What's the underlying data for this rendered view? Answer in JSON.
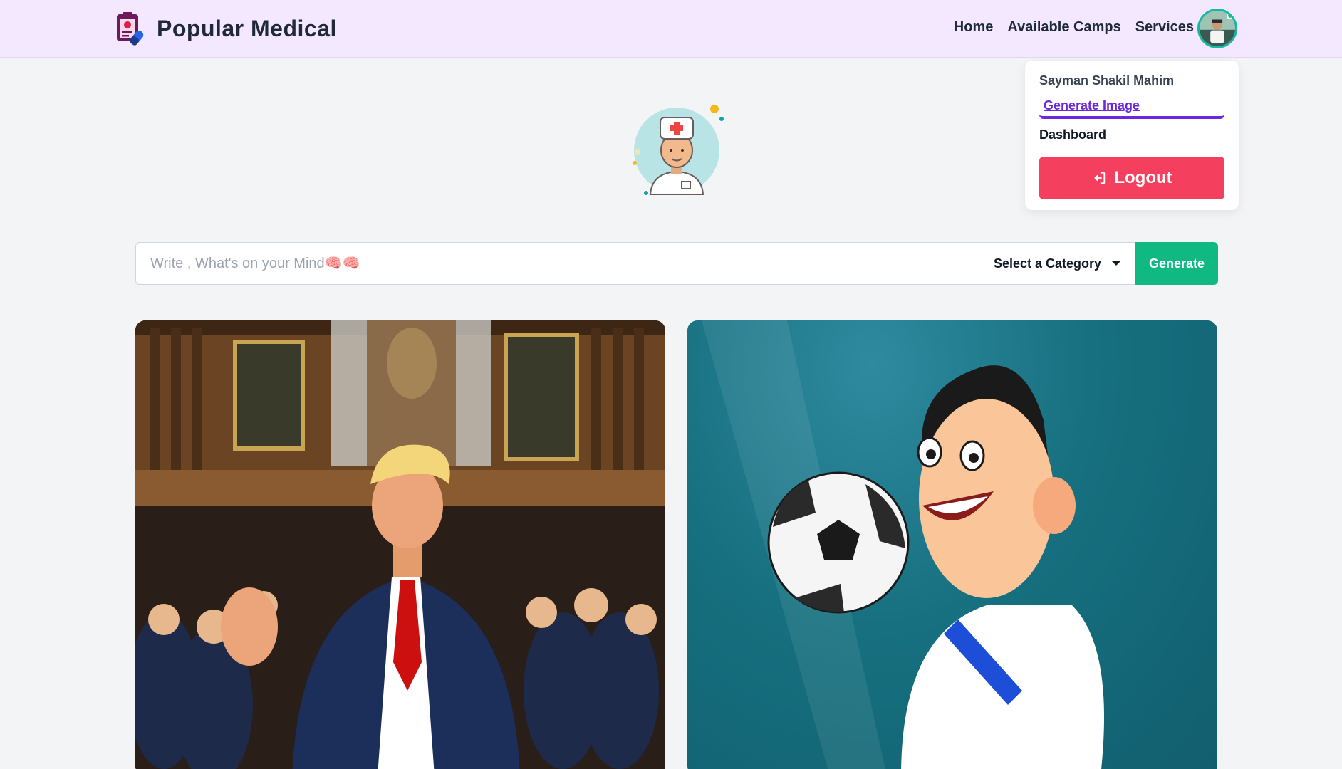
{
  "navbar": {
    "brand": "Popular Medical",
    "links": [
      "Home",
      "Available Camps",
      "Services"
    ]
  },
  "dropdown": {
    "user_name": "Sayman Shakil Mahim",
    "generate_label": "Generate Image",
    "dashboard_label": "Dashboard",
    "logout_label": "Logout"
  },
  "search": {
    "placeholder": "Write , What's on your Mind🧠🧠",
    "value": "",
    "category_label": "Select a Category",
    "generate_button": "Generate"
  },
  "colors": {
    "navbar_bg": "#f3e8ff",
    "accent_purple": "#6d28d9",
    "logout_red": "#f43f5e",
    "generate_green": "#10b981"
  }
}
